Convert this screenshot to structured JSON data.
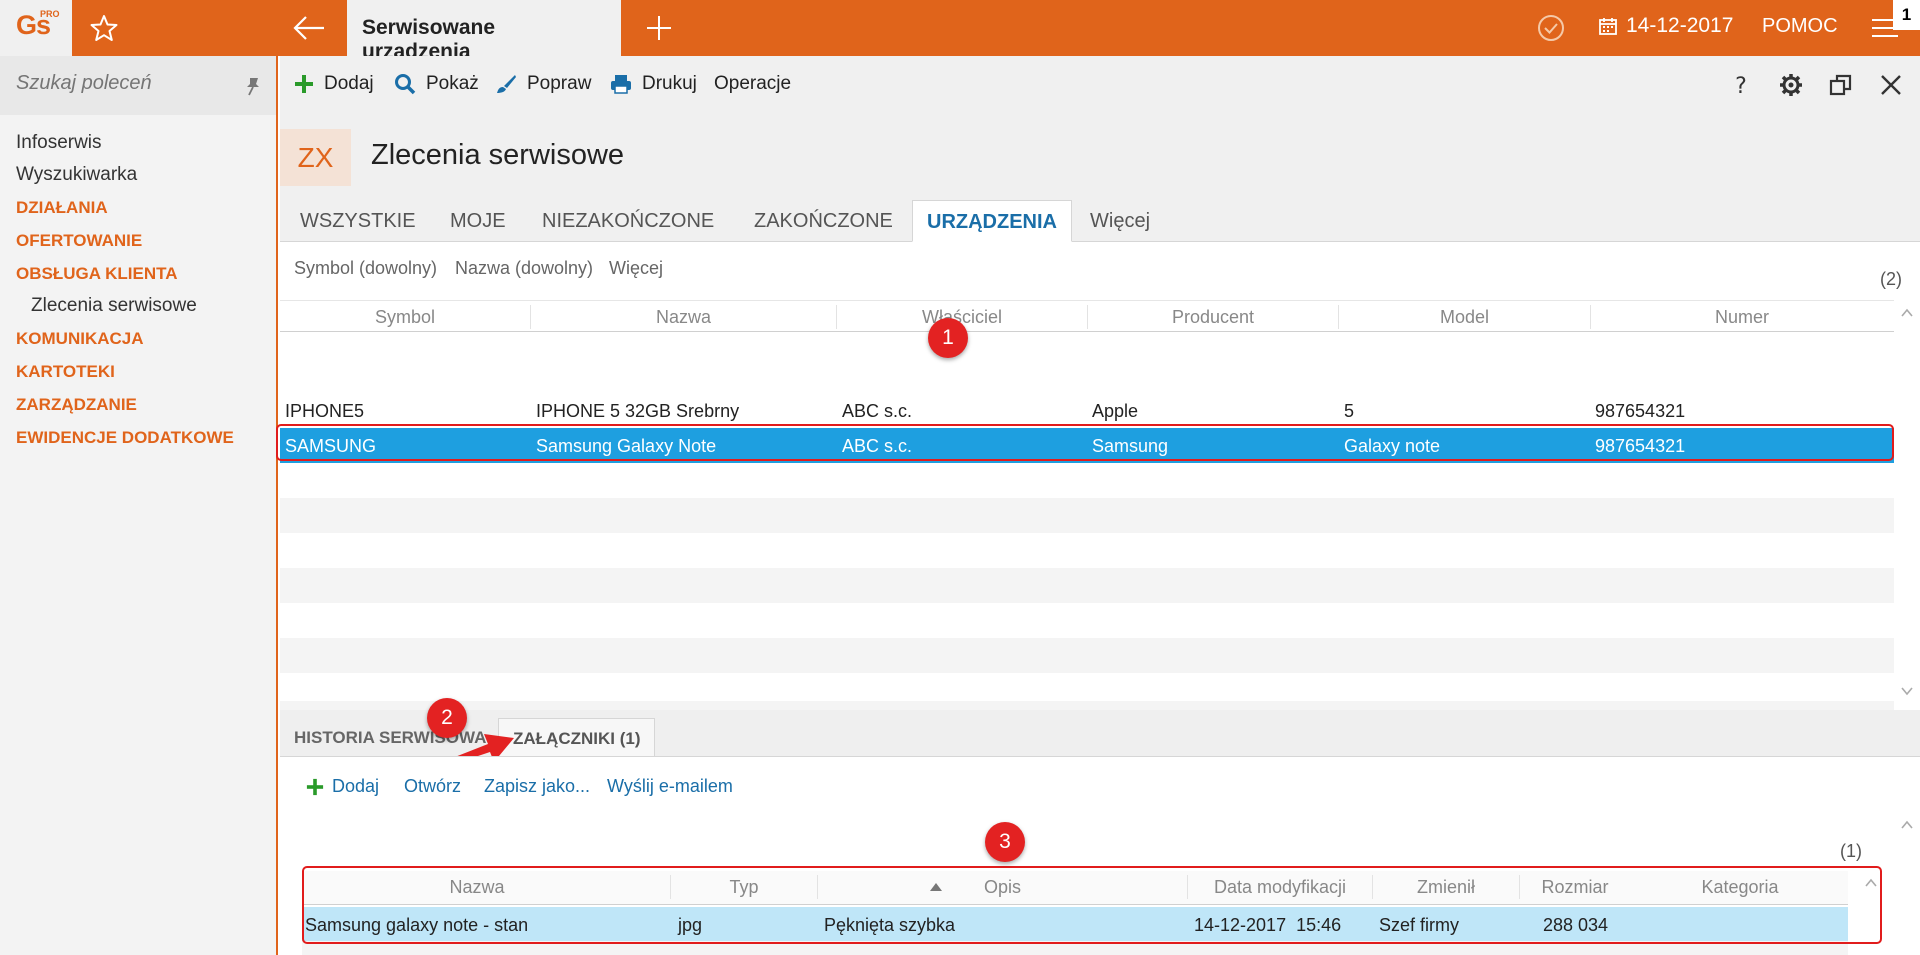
{
  "topbar": {
    "logo": "Gs",
    "logo_pro": "PRO",
    "active_tab": "Serwisowane urządzenia",
    "date": "14-12-2017",
    "help": "POMOC",
    "badge": "1"
  },
  "sidebar": {
    "search_placeholder": "Szukaj poleceń",
    "items": [
      {
        "label": "Infoserwis",
        "style": "plain"
      },
      {
        "label": "Wyszukiwarka",
        "style": "plain"
      },
      {
        "label": "DZIAŁANIA",
        "style": "section"
      },
      {
        "label": "OFERTOWANIE",
        "style": "section"
      },
      {
        "label": "OBSŁUGA KLIENTA",
        "style": "section"
      },
      {
        "label": "Zlecenia serwisowe",
        "style": "sub"
      },
      {
        "label": "KOMUNIKACJA",
        "style": "section"
      },
      {
        "label": "KARTOTEKI",
        "style": "section"
      },
      {
        "label": "ZARZĄDZANIE",
        "style": "section"
      },
      {
        "label": "EWIDENCJE DODATKOWE",
        "style": "section"
      }
    ]
  },
  "toolbar": {
    "add": "Dodaj",
    "show": "Pokaż",
    "edit": "Popraw",
    "print": "Drukuj",
    "operations": "Operacje"
  },
  "header": {
    "badge": "ZX",
    "title": "Zlecenia serwisowe"
  },
  "tabs": [
    "WSZYSTKIE",
    "MOJE",
    "NIEZAKOŃCZONE",
    "ZAKOŃCZONE",
    "URZĄDZENIA",
    "Więcej"
  ],
  "active_tab_index": 4,
  "filters": [
    "Symbol (dowolny)",
    "Nazwa (dowolny)",
    "Więcej"
  ],
  "grid": {
    "count": "(2)",
    "columns": [
      "Symbol",
      "Nazwa",
      "Właściciel",
      "Producent",
      "Model",
      "Numer"
    ],
    "rows": [
      [
        "IPHONE5",
        "IPHONE 5 32GB Srebrny",
        "ABC s.c.",
        "Apple",
        "5",
        "987654321"
      ],
      [
        "SAMSUNG",
        "Samsung Galaxy Note",
        "ABC s.c.",
        "Samsung",
        "Galaxy note",
        "987654321"
      ]
    ],
    "selected_row": 1
  },
  "subtabs": [
    "HISTORIA SERWISOWA",
    "ZAŁĄCZNIKI (1)"
  ],
  "attachments": {
    "toolbar": [
      "Dodaj",
      "Otwórz",
      "Zapisz jako...",
      "Wyślij e-mailem"
    ],
    "count": "(1)",
    "columns": [
      "Nazwa",
      "Typ",
      "Opis",
      "Data modyfikacji",
      "Zmienił",
      "Rozmiar",
      "Kategoria"
    ],
    "row": [
      "Samsung galaxy note - stan",
      "jpg",
      "Pęknięta szybka",
      "14-12-2017  15:46",
      "Szef firmy",
      "288 034",
      ""
    ]
  },
  "annotations": [
    "1",
    "2",
    "3"
  ],
  "colors": {
    "accent": "#e0641b",
    "selection": "#1e9fe0",
    "highlight_red": "#e11c1c",
    "link_blue": "#1a6ea8"
  }
}
